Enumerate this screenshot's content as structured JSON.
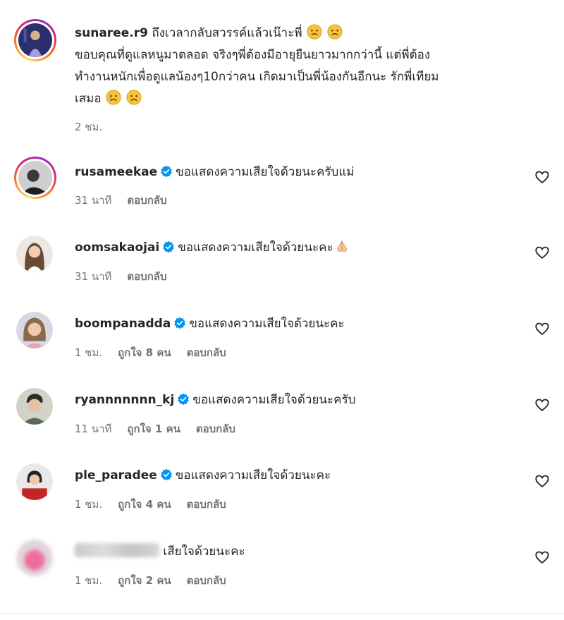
{
  "colors": {
    "verified": "#0095f6",
    "meta_text": "#737373",
    "text": "#262626"
  },
  "main_comment": {
    "username": "sunaree.r9",
    "line1": "ถึงเวลากลับสวรรค์แล้วเน๊าะพี่",
    "line2": "ขอบคุณที่ดูแลหนูมาตลอด จริงๆพี่ต้องมีอายุยืนยาวมากกว่านี้ แต่พี่ต้อง",
    "line3": "ทำงานหนักเพื่อดูแลน้องๆ10กว่าคน เกิดมาเป็นพี่น้องกันอีกนะ รักพี่เทียม",
    "line4": "เสมอ",
    "emoji": "sad-face",
    "time": "2 ชม."
  },
  "replies": [
    {
      "username": "rusameekae",
      "verified": true,
      "text": "ขอแสดงความเสียใจด้วยนะครับแม่",
      "time": "31 นาที",
      "likes": "",
      "reply_label": "ตอบกลับ"
    },
    {
      "username": "oomsakaojai",
      "verified": true,
      "text": "ขอแสดงความเสียใจด้วยนะคะ",
      "emoji": "folded-hands",
      "time": "31 นาที",
      "likes": "",
      "reply_label": "ตอบกลับ"
    },
    {
      "username": "boompanadda",
      "verified": true,
      "text": "ขอแสดงความเสียใจด้วยนะคะ",
      "time": "1 ชม.",
      "likes": "ถูกใจ 8 คน",
      "reply_label": "ตอบกลับ"
    },
    {
      "username": "ryannnnnnn_kj",
      "verified": true,
      "text": "ขอแสดงความเสียใจด้วยนะครับ",
      "time": "11 นาที",
      "likes": "ถูกใจ 1 คน",
      "reply_label": "ตอบกลับ"
    },
    {
      "username": "ple_paradee",
      "verified": true,
      "text": "ขอแสดงความเสียใจด้วยนะคะ",
      "time": "1 ชม.",
      "likes": "ถูกใจ 4 คน",
      "reply_label": "ตอบกลับ"
    },
    {
      "username": "",
      "verified": false,
      "text": "เสียใจด้วยนะคะ",
      "time": "1 ชม.",
      "likes": "ถูกใจ 2 คน",
      "reply_label": "ตอบกลับ"
    }
  ]
}
